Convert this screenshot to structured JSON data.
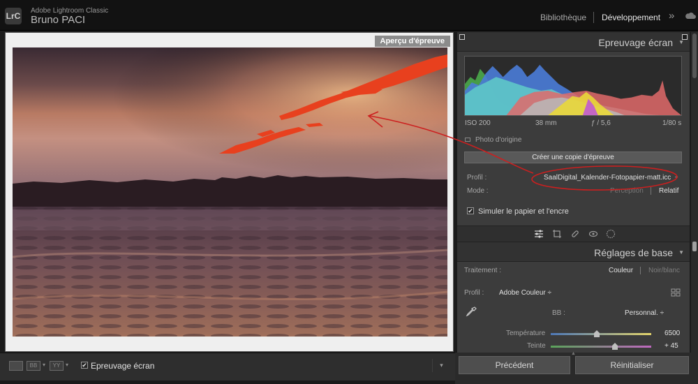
{
  "app": {
    "logo": "LrC",
    "title": "Adobe Lightroom Classic",
    "user": "Bruno PACI"
  },
  "modules": {
    "library": "Bibliothèque",
    "develop": "Développement",
    "more": "»",
    "cloud_icon": "cloud-icon"
  },
  "preview": {
    "label": "Aperçu d'épreuve"
  },
  "toolbar": {
    "view_ba": "BB",
    "view_yy": "YY",
    "menu_arrow": "▾",
    "softproof_checked": "✔",
    "softproof_label": "Epreuvage écran"
  },
  "softproof_panel": {
    "title": "Epreuvage écran",
    "exif": {
      "iso": "ISO 200",
      "focal": "38 mm",
      "aperture": "ƒ / 5,6",
      "shutter": "1/80 s"
    },
    "original_label": "Photo d'origine",
    "create_copy_button": "Créer une copie d'épreuve",
    "profile_label": "Profil :",
    "profile_value": "SaalDigital_Kalender-Fotopapier-matt.icc",
    "profile_arrow": "÷",
    "mode_label": "Mode :",
    "mode_perception": "Perception",
    "mode_relatif": "Relatif",
    "simulate_checked": "✔",
    "simulate_label": "Simuler le papier et l'encre"
  },
  "basic_panel": {
    "title": "Réglages de base",
    "treatment_label": "Traitement :",
    "treatment_color": "Couleur",
    "treatment_bw": "Noir/blanc",
    "profile_label": "Profil :",
    "profile_value": "Adobe Couleur ÷",
    "wb_label": "BB :",
    "wb_value": "Personnal. ÷",
    "temperature_label": "Température",
    "temperature_value": "6500",
    "tint_label": "Teinte",
    "tint_value": "+ 45"
  },
  "bottom_buttons": {
    "previous": "Précédent",
    "reset": "Réinitialiser"
  },
  "colors": {
    "accent_annotation": "#cc1f1f",
    "gamut_warning": "#e8401e",
    "panel_bg": "#3c3c3c"
  }
}
